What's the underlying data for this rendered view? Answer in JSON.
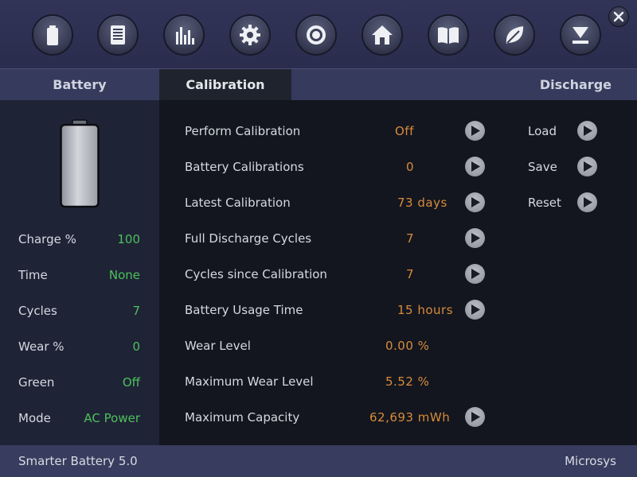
{
  "toolbar": {
    "icons": [
      "battery-icon",
      "list-icon",
      "bar-chart-icon",
      "gear-icon",
      "target-icon",
      "home-icon",
      "book-icon",
      "leaf-icon",
      "download-icon"
    ],
    "close_icon": "close-icon"
  },
  "tabs": {
    "battery": "Battery",
    "calibration": "Calibration",
    "discharge": "Discharge"
  },
  "sidebar": {
    "rows": [
      {
        "label": "Charge %",
        "value": "100"
      },
      {
        "label": "Time",
        "value": "None"
      },
      {
        "label": "Cycles",
        "value": "7"
      },
      {
        "label": "Wear %",
        "value": "0"
      },
      {
        "label": "Green",
        "value": "Off"
      },
      {
        "label": "Mode",
        "value": "AC Power"
      }
    ]
  },
  "calibration": {
    "rows": [
      {
        "label": "Perform Calibration",
        "value": "Off",
        "action": true
      },
      {
        "label": "Battery Calibrations",
        "value": "0",
        "action": true
      },
      {
        "label": "Latest Calibration",
        "value": "73 days",
        "action": true
      },
      {
        "label": "Full Discharge Cycles",
        "value": "7",
        "action": true
      },
      {
        "label": "Cycles since Calibration",
        "value": "7",
        "action": true
      },
      {
        "label": "Battery Usage Time",
        "value": "15 hours",
        "action": true
      },
      {
        "label": "Wear Level",
        "value": "0.00 %",
        "action": false
      },
      {
        "label": "Maximum Wear Level",
        "value": "5.52 %",
        "action": false
      },
      {
        "label": "Maximum Capacity",
        "value": "62,693 mWh",
        "action": true
      }
    ],
    "side_actions": [
      "Load",
      "Save",
      "Reset"
    ]
  },
  "statusbar": {
    "app": "Smarter Battery 5.0",
    "vendor": "Microsys"
  },
  "colors": {
    "value_green": "#4cc15b",
    "value_orange": "#d88b3d",
    "active_tab": "#1f232d"
  }
}
